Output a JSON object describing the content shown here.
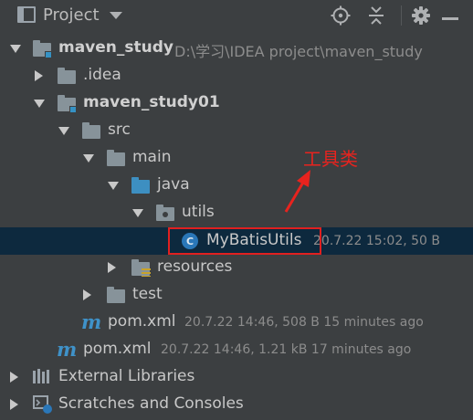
{
  "toolbar": {
    "title": "Project",
    "icons": [
      "locate-icon",
      "collapse-icon",
      "gear-icon",
      "minimize-icon"
    ]
  },
  "tree": {
    "root": {
      "label": "maven_study",
      "path": "D:\\学习\\IDEA project\\maven_study"
    },
    "idea": {
      "label": ".idea"
    },
    "module": {
      "label": "maven_study01"
    },
    "src": {
      "label": "src"
    },
    "main": {
      "label": "main"
    },
    "java": {
      "label": "java"
    },
    "utils": {
      "label": "utils"
    },
    "mybatisutils": {
      "icon": "C",
      "label": "MyBatisUtils",
      "meta": "20.7.22 15:02, 50 B"
    },
    "resources": {
      "label": "resources"
    },
    "test": {
      "label": "test"
    },
    "pom_module": {
      "icon": "m",
      "label": "pom.xml",
      "meta": "20.7.22 14:46, 508 B 15 minutes ago"
    },
    "pom_root": {
      "icon": "m",
      "label": "pom.xml",
      "meta": "20.7.22 14:46, 1.21 kB 17 minutes ago"
    },
    "external_libraries": {
      "label": "External Libraries"
    },
    "scratches": {
      "label": "Scratches and Consoles"
    }
  },
  "annotation": {
    "text": "工具类",
    "color": "#e8231e"
  },
  "colors": {
    "background": "#3c3f41",
    "selection": "#0d293e",
    "folder": "#87939a",
    "source_folder": "#3d8fc1",
    "module_badge": "#3592c4",
    "maven": "#3f92c9",
    "highlight": "#e02020"
  }
}
